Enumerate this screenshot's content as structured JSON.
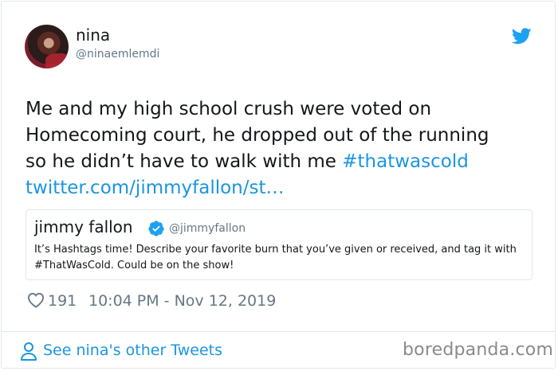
{
  "tweet": {
    "author_name": "nina",
    "author_handle": "@ninaemlemdi",
    "text_plain": "Me and my high school crush were voted on\nHomecoming court, he dropped out of the running\nso he didn’t have to walk with me ",
    "hashtag": "#thatwascold",
    "link": "twitter.com/jimmyfallon/st…",
    "likes": "191",
    "timestamp": "10:04 PM - Nov 12, 2019"
  },
  "quoted": {
    "author_name": "jimmy fallon",
    "author_handle": "@jimmyfallon",
    "text": "It’s Hashtags time! Describe your favorite burn that you’ve given or received, and tag it with #ThatWasCold. Could be on the show!"
  },
  "footer": {
    "link_label": "See nina's other Tweets",
    "watermark": "boredpanda.com"
  },
  "colors": {
    "link_blue": "#1b95e0",
    "muted_gray": "#657786",
    "border": "#e1e8ed",
    "verified_blue": "#1da1f2"
  },
  "icons": [
    "twitter-bird-icon",
    "verified-badge-icon",
    "heart-icon",
    "person-icon"
  ]
}
